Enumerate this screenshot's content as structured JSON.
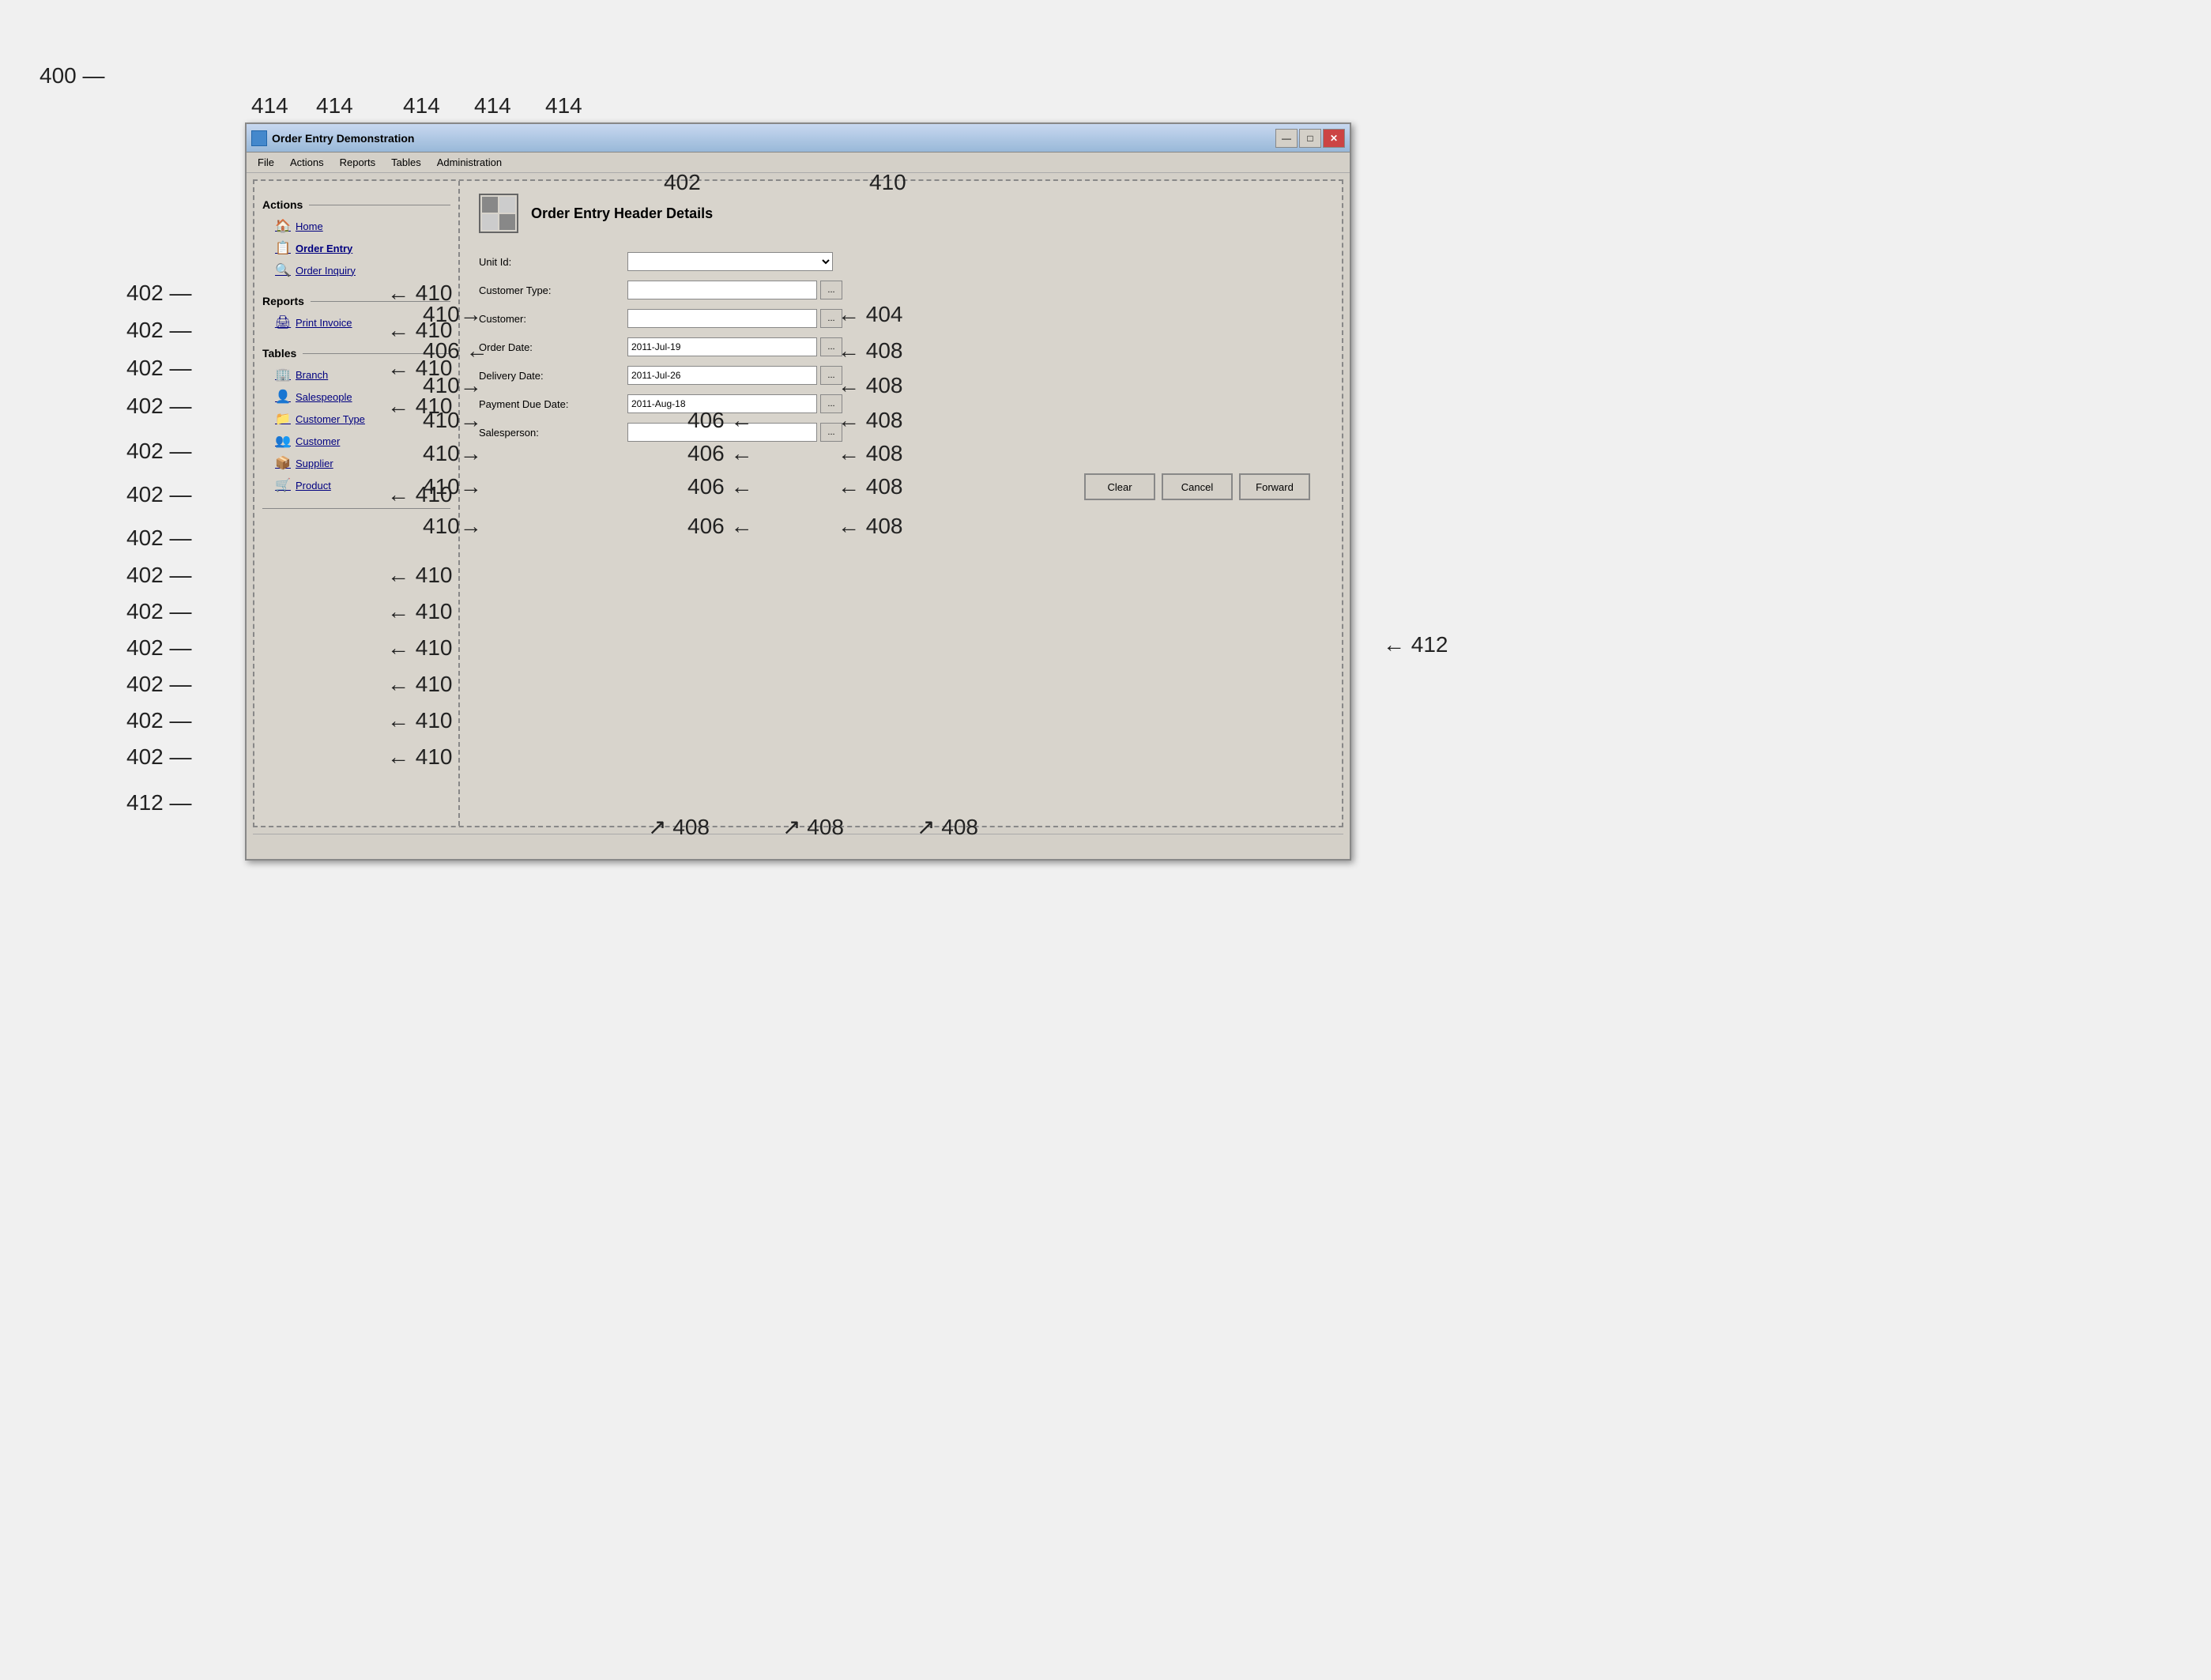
{
  "annotations": {
    "fig_number": "400",
    "labels": {
      "414": "414",
      "402": "402",
      "404": "404",
      "406": "406",
      "408": "408",
      "410": "410",
      "412": "412"
    }
  },
  "window": {
    "title": "Order Entry Demonstration",
    "controls": {
      "minimize": "—",
      "maximize": "□",
      "close": "✕"
    }
  },
  "menu": {
    "items": [
      "File",
      "Actions",
      "Reports",
      "Tables",
      "Administration"
    ]
  },
  "left_panel": {
    "sections": [
      {
        "id": "actions",
        "header": "Actions",
        "items": [
          {
            "label": "Home",
            "icon": "🏠"
          },
          {
            "label": "Order Entry",
            "icon": "📋",
            "bold": true
          },
          {
            "label": "Order Inquiry",
            "icon": "🔍"
          }
        ]
      },
      {
        "id": "reports",
        "header": "Reports",
        "items": [
          {
            "label": "Print Invoice",
            "icon": "🖨"
          }
        ]
      },
      {
        "id": "tables",
        "header": "Tables",
        "items": [
          {
            "label": "Branch",
            "icon": "🏢"
          },
          {
            "label": "Salespeople",
            "icon": "👤"
          },
          {
            "label": "Customer Type",
            "icon": "📁"
          },
          {
            "label": "Customer",
            "icon": "👥"
          },
          {
            "label": "Supplier",
            "icon": "📦"
          },
          {
            "label": "Product",
            "icon": "🛒"
          }
        ]
      }
    ]
  },
  "right_panel": {
    "title": "Order Entry Header Details",
    "fields": [
      {
        "id": "unit_id",
        "label": "Unit Id:",
        "type": "select",
        "value": ""
      },
      {
        "id": "customer_type",
        "label": "Customer Type:",
        "type": "text_browse",
        "value": ""
      },
      {
        "id": "customer",
        "label": "Customer:",
        "type": "text_browse",
        "value": ""
      },
      {
        "id": "order_date",
        "label": "Order Date:",
        "type": "text_browse",
        "value": "2011-Jul-19"
      },
      {
        "id": "delivery_date",
        "label": "Delivery Date:",
        "type": "text_browse",
        "value": "2011-Jul-26"
      },
      {
        "id": "payment_due_date",
        "label": "Payment Due Date:",
        "type": "text_browse",
        "value": "2011-Aug-18"
      },
      {
        "id": "salesperson",
        "label": "Salesperson:",
        "type": "text_browse",
        "value": ""
      }
    ],
    "buttons": [
      {
        "id": "clear",
        "label": "Clear"
      },
      {
        "id": "cancel",
        "label": "Cancel"
      },
      {
        "id": "forward",
        "label": "Forward"
      }
    ]
  },
  "status_bar": {
    "text": ""
  }
}
